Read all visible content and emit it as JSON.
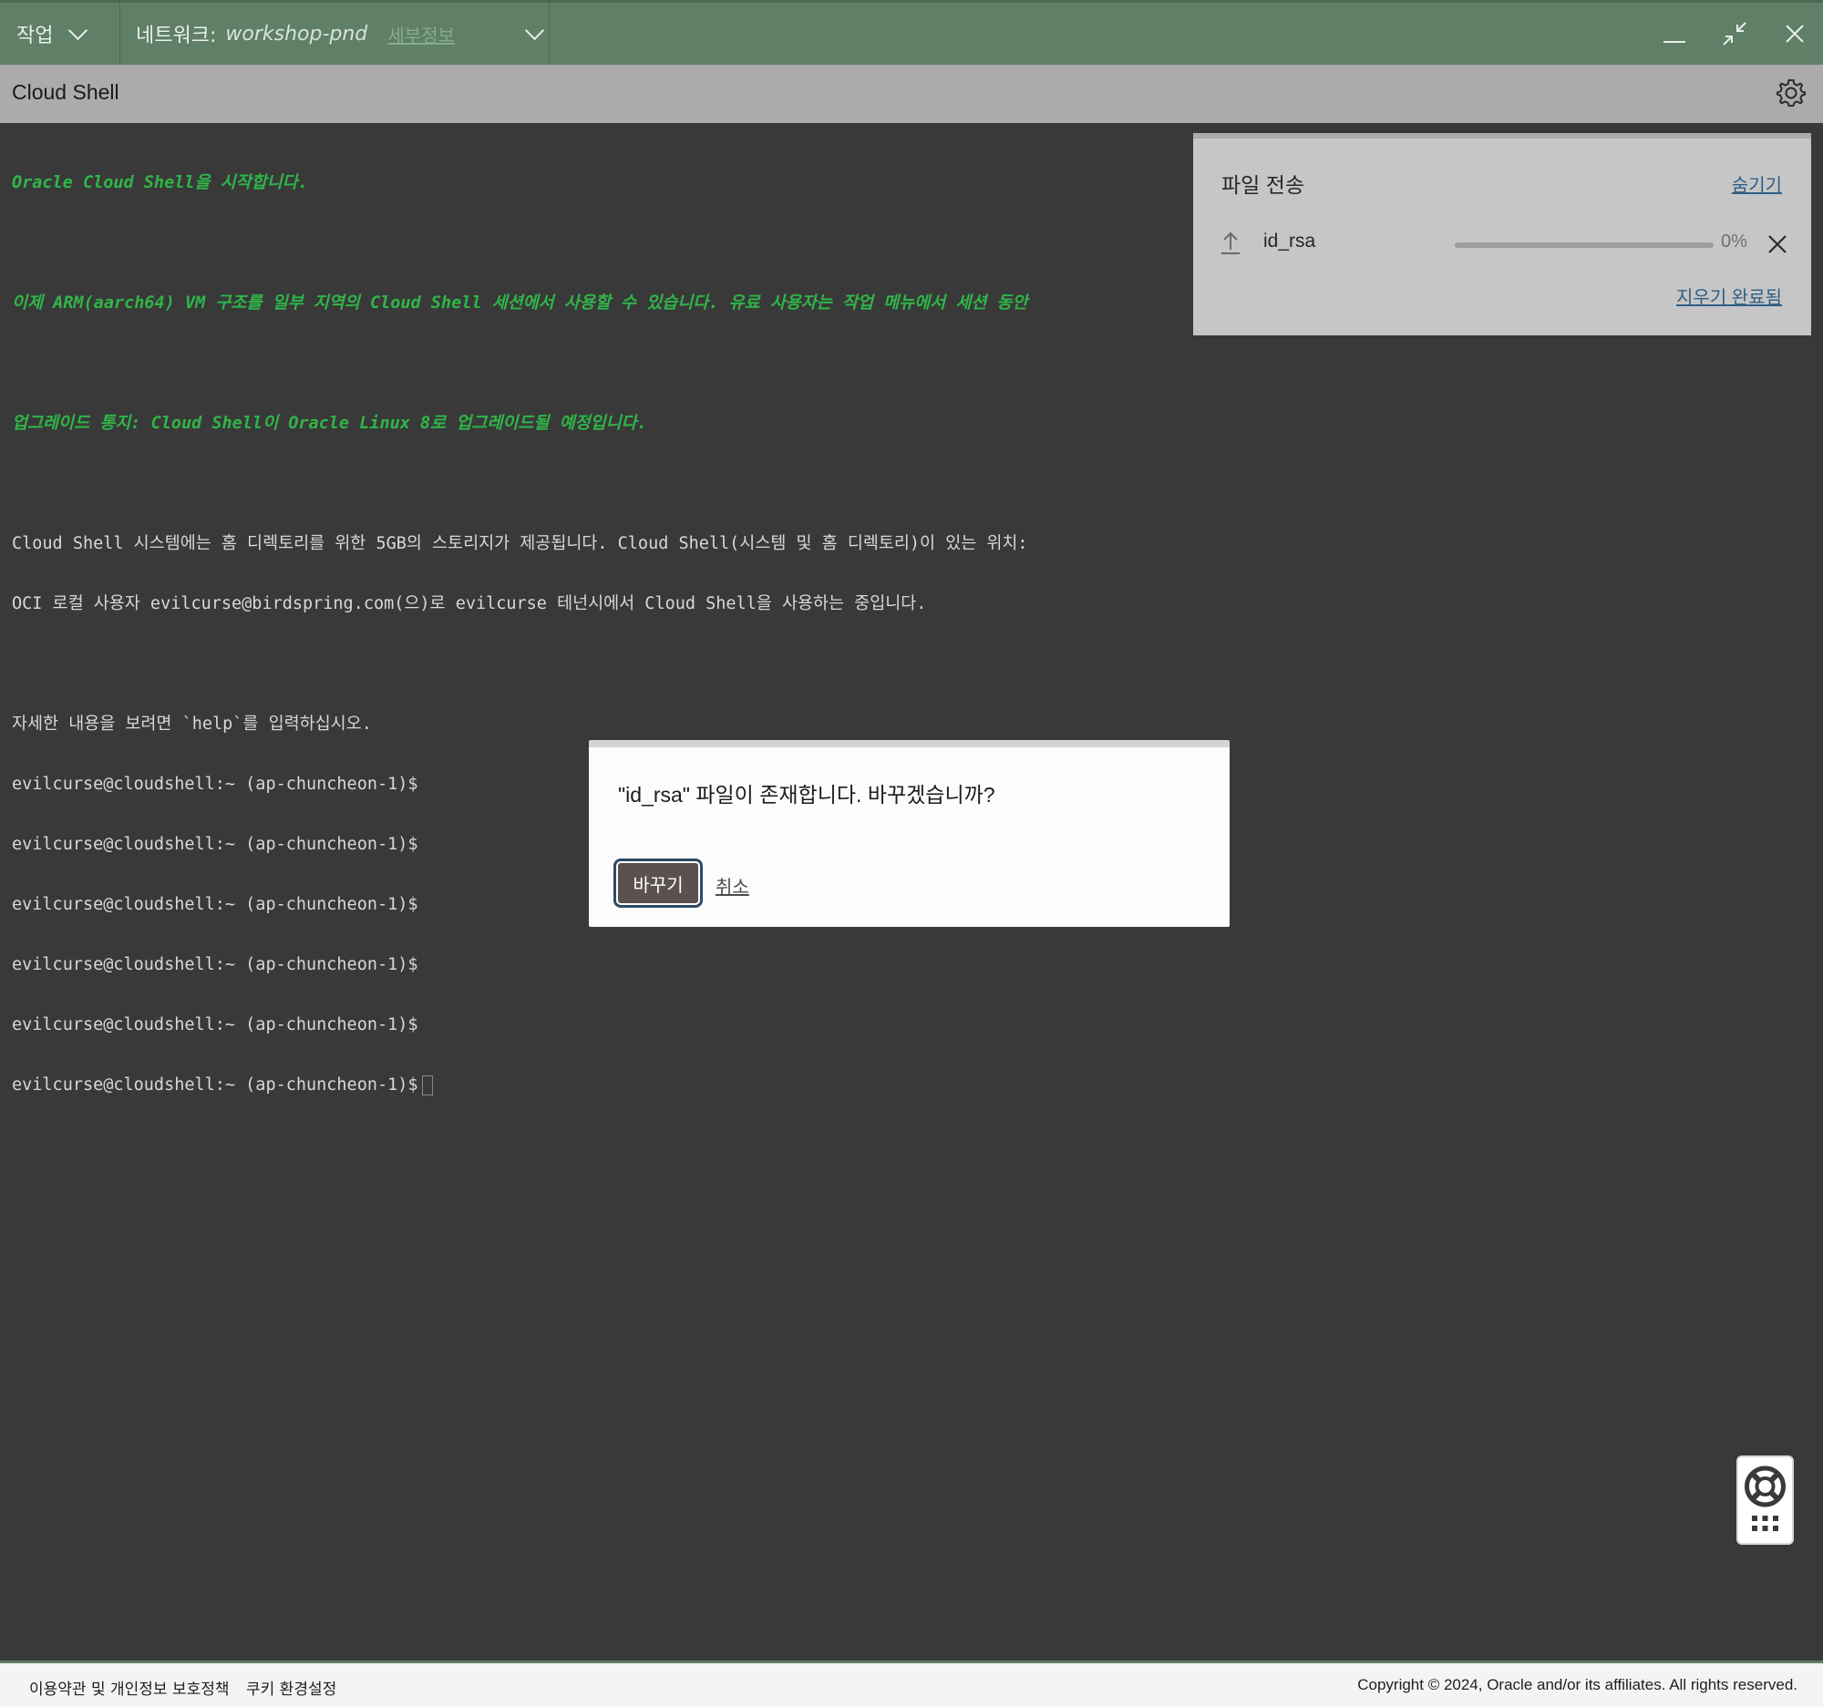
{
  "topbar": {
    "actions_label": "작업",
    "network_label": "네트워크:",
    "network_value": "workshop-pnd",
    "network_details": "세부정보"
  },
  "shell": {
    "title": "Cloud Shell"
  },
  "terminal": {
    "green_lines": [
      "Oracle Cloud Shell을 시작합니다.",
      "이제 ARM(aarch64) VM 구조를 일부 지역의 Cloud Shell 세션에서 사용할 수 있습니다. 유료 사용자는 작업 메뉴에서 세션 동안",
      "업그레이드 통지: Cloud Shell이 Oracle Linux 8로 업그레이드될 예정입니다."
    ],
    "info_lines": [
      "Cloud Shell 시스템에는 홈 디렉토리를 위한 5GB의 스토리지가 제공됩니다. Cloud Shell(시스템 및 홈 디렉토리)이 있는 위치:",
      "OCI 로컬 사용자 evilcurse@birdspring.com(으)로 evilcurse 테넌시에서 Cloud Shell을 사용하는 중입니다."
    ],
    "help_line": "자세한 내용을 보려면 `help`를 입력하십시오.",
    "prompt": "evilcurse@cloudshell:~ (ap-chuncheon-1)$"
  },
  "file_transfer": {
    "title": "파일 전송",
    "hide_label": "숨기기",
    "file_name": "id_rsa",
    "progress_text": "0%",
    "progress_value": 0,
    "clear_label": "지우기 완료됨"
  },
  "dialog": {
    "message": "\"id_rsa\" 파일이 존재합니다. 바꾸겠습니까?",
    "replace_label": "바꾸기",
    "cancel_label": "취소"
  },
  "footer": {
    "terms": "이용약관 및 개인정보 보호정책",
    "cookies": "쿠키 환경설정",
    "copyright": "Copyright © 2024, Oracle and/or its affiliates. All rights reserved."
  }
}
